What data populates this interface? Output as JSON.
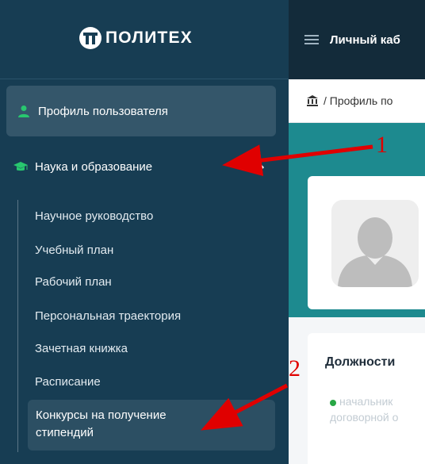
{
  "sidebar": {
    "brand": "ПОЛИТЕХ",
    "profile_label": "Профиль пользователя",
    "section_label": "Наука и образование",
    "items": [
      "Научное руководство",
      "Учебный план",
      "Рабочий план",
      "Персональная траектория",
      "Зачетная книжка",
      "Расписание"
    ],
    "active_item_line1": "Конкурсы на получение",
    "active_item_line2": "стипендий"
  },
  "header": {
    "title": "Личный каб"
  },
  "breadcrumb": {
    "text": "/ Профиль по"
  },
  "main": {
    "positions_heading": "Должности",
    "position_line1": "начальник",
    "position_line2": "договорной о"
  },
  "annotations": {
    "marker1": "1",
    "marker2": "2",
    "color": "#e00000"
  },
  "colors": {
    "sidebar": "#173d53",
    "topbar": "#132b3a",
    "teal": "#1d8a8f",
    "accent_green": "#28a745"
  }
}
